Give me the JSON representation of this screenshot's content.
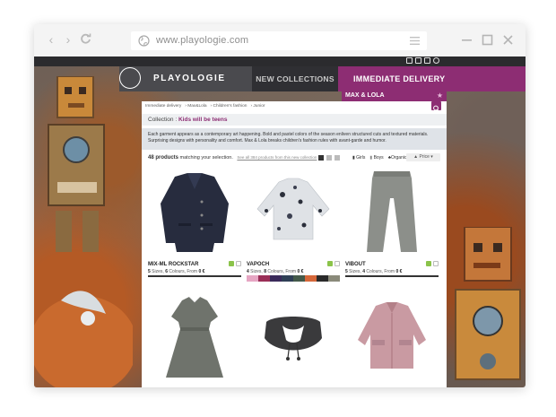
{
  "browser": {
    "url": "www.playologie.com",
    "icons": [
      "back-icon",
      "forward-icon",
      "reload-icon",
      "globe-icon",
      "menu-icon",
      "minimize-icon",
      "maximize-icon",
      "close-icon"
    ]
  },
  "site": {
    "logo": "PLAYOLOGIE",
    "nav": {
      "new_collections": "NEW COLLECTIONS",
      "immediate_delivery": "IMMEDIATE DELIVERY"
    },
    "brand": "MAX & LOLA",
    "breadcrumb": [
      "Immediate delivery",
      "Max&Lola",
      "Children's fashion",
      "Junior"
    ],
    "collection_label": "Collection :",
    "collection_name": "Kids will be teens",
    "description_line1": "Each garment appears as a contemporary art happening. Bold and pastel colors of the season enliven structured cuts and textured materials.",
    "description_line2": "Surprising designs with personality and comfort. Max & Lola breaks children's fashion rules with avant-garde and humor.",
    "product_count": "48 products",
    "matching_text": "matching your selection.",
    "see_all_link": "See all 384 products from this new collection",
    "filters": {
      "girls": "Girls",
      "boys": "Boys",
      "organic": "Organic",
      "price": "Price"
    },
    "accent_color": "#8d2d73"
  },
  "products": [
    {
      "name": "MIX-ML ROCKSTAR",
      "sizes_n": "5",
      "sizes_label": "Sizes,",
      "colours_n": "6",
      "colours_label": "Colours,",
      "from_label": "From",
      "price": "0 €"
    },
    {
      "name": "VAPOCH",
      "sizes_n": "4",
      "sizes_label": "Sizes,",
      "colours_n": "8",
      "colours_label": "Colours,",
      "from_label": "From",
      "price": "0 €"
    },
    {
      "name": "VIBOUT",
      "sizes_n": "5",
      "sizes_label": "Sizes,",
      "colours_n": "4",
      "colours_label": "Colours,",
      "from_label": "From",
      "price": "0 €"
    },
    {
      "name": "",
      "sizes_n": "",
      "sizes_label": "",
      "colours_n": "",
      "colours_label": "",
      "from_label": "",
      "price": ""
    },
    {
      "name": "",
      "sizes_n": "",
      "sizes_label": "",
      "colours_n": "",
      "colours_label": "",
      "from_label": "",
      "price": ""
    },
    {
      "name": "",
      "sizes_n": "",
      "sizes_label": "",
      "colours_n": "",
      "colours_label": "",
      "from_label": "",
      "price": ""
    }
  ]
}
